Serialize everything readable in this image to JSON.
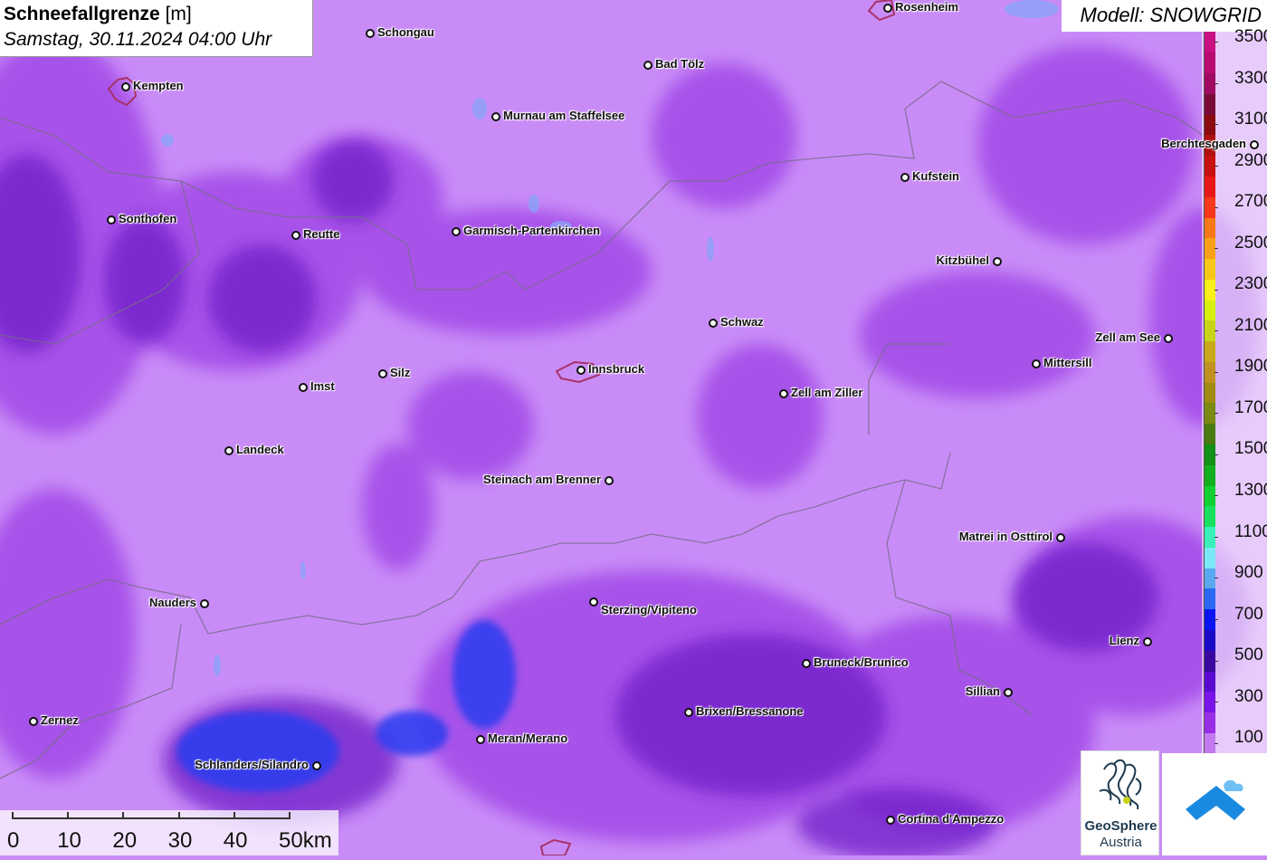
{
  "header": {
    "title_bold": "Schneefallgrenze",
    "title_unit": "[m]",
    "datetime": "Samstag, 30.11.2024 04:00 Uhr"
  },
  "model_label": "Modell: SNOWGRID",
  "legend": {
    "levels": [
      {
        "label": "100",
        "color": "#c27af0"
      },
      {
        "label": "",
        "color": "#9a2ee6"
      },
      {
        "label": "300",
        "color": "#7a14e8"
      },
      {
        "label": "",
        "color": "#5a0ad0"
      },
      {
        "label": "500",
        "color": "#3a0aa0"
      },
      {
        "label": "",
        "color": "#1a0ac8"
      },
      {
        "label": "700",
        "color": "#0a14f0"
      },
      {
        "label": "",
        "color": "#2a6af2"
      },
      {
        "label": "900",
        "color": "#5aa8f0"
      },
      {
        "label": "",
        "color": "#7ae8f6"
      },
      {
        "label": "1100",
        "color": "#3af0b8"
      },
      {
        "label": "",
        "color": "#1ae060"
      },
      {
        "label": "1300",
        "color": "#12d030"
      },
      {
        "label": "",
        "color": "#12b020"
      },
      {
        "label": "1500",
        "color": "#129018"
      },
      {
        "label": "",
        "color": "#4a7a12"
      },
      {
        "label": "1700",
        "color": "#7a8a12"
      },
      {
        "label": "",
        "color": "#a08a12"
      },
      {
        "label": "1900",
        "color": "#c09020"
      },
      {
        "label": "",
        "color": "#c8a818"
      },
      {
        "label": "2100",
        "color": "#c8d418"
      },
      {
        "label": "",
        "color": "#d8f010"
      },
      {
        "label": "2300",
        "color": "#f8f018"
      },
      {
        "label": "",
        "color": "#f8c818"
      },
      {
        "label": "2500",
        "color": "#f8a018"
      },
      {
        "label": "",
        "color": "#f87818"
      },
      {
        "label": "2700",
        "color": "#f83818"
      },
      {
        "label": "",
        "color": "#e81818"
      },
      {
        "label": "2900",
        "color": "#c81010"
      },
      {
        "label": "",
        "color": "#b01010"
      },
      {
        "label": "3100",
        "color": "#8a0a10"
      },
      {
        "label": "",
        "color": "#7a0a38"
      },
      {
        "label": "3300",
        "color": "#a00a60"
      },
      {
        "label": "",
        "color": "#b80a70"
      },
      {
        "label": "3500",
        "color": "#c81080"
      }
    ]
  },
  "scale_bar": {
    "labels": [
      "0",
      "10",
      "20",
      "30",
      "40",
      "50km"
    ]
  },
  "logo": {
    "name": "GeoSphere",
    "sub": "Austria"
  },
  "cities": [
    {
      "name": "Rosenheim",
      "dot": [
        981,
        9
      ],
      "side": "r"
    },
    {
      "name": "Schongau",
      "dot": [
        409,
        37
      ],
      "side": "r"
    },
    {
      "name": "Bad Tölz",
      "dot": [
        716,
        72
      ],
      "side": "r"
    },
    {
      "name": "Kempten",
      "dot": [
        139,
        96
      ],
      "side": "r"
    },
    {
      "name": "Murnau am Staffelsee",
      "dot": [
        548,
        129
      ],
      "side": "r"
    },
    {
      "name": "Berchtesgaden",
      "dot": [
        1386,
        160
      ],
      "side": "l"
    },
    {
      "name": "Kufstein",
      "dot": [
        1000,
        196
      ],
      "side": "r"
    },
    {
      "name": "Sonthofen",
      "dot": [
        123,
        243
      ],
      "side": "r"
    },
    {
      "name": "Garmisch-Partenkirchen",
      "dot": [
        504,
        256
      ],
      "side": "r"
    },
    {
      "name": "Reutte",
      "dot": [
        327,
        260
      ],
      "side": "r"
    },
    {
      "name": "Kitzbühel",
      "dot": [
        1102,
        289
      ],
      "side": "l"
    },
    {
      "name": "Schwaz",
      "dot": [
        788,
        357
      ],
      "side": "r"
    },
    {
      "name": "Zell am See",
      "dot": [
        1291,
        374
      ],
      "side": "l"
    },
    {
      "name": "Mittersill",
      "dot": [
        1145,
        402
      ],
      "side": "r"
    },
    {
      "name": "Innsbruck",
      "dot": [
        642,
        409
      ],
      "side": "r"
    },
    {
      "name": "Silz",
      "dot": [
        423,
        413
      ],
      "side": "r"
    },
    {
      "name": "Imst",
      "dot": [
        335,
        428
      ],
      "side": "r"
    },
    {
      "name": "Zell am Ziller",
      "dot": [
        866,
        435
      ],
      "side": "r"
    },
    {
      "name": "Landeck",
      "dot": [
        253,
        498
      ],
      "side": "r"
    },
    {
      "name": "Steinach am Brenner",
      "dot": [
        673,
        531
      ],
      "side": "l"
    },
    {
      "name": "Matrei in Osttirol",
      "dot": [
        1172,
        594
      ],
      "side": "l"
    },
    {
      "name": "Nauders",
      "dot": [
        226,
        667
      ],
      "side": "l"
    },
    {
      "name": "Sterzing/Vipiteno",
      "dot": [
        656,
        665
      ],
      "side": "rb"
    },
    {
      "name": "Lienz",
      "dot": [
        1268,
        709
      ],
      "side": "l"
    },
    {
      "name": "Bruneck/Brunico",
      "dot": [
        891,
        733
      ],
      "side": "r"
    },
    {
      "name": "Sillian",
      "dot": [
        1114,
        765
      ],
      "side": "l"
    },
    {
      "name": "Brixen/Bressanone",
      "dot": [
        761,
        787
      ],
      "side": "r"
    },
    {
      "name": "Zernez",
      "dot": [
        37,
        797
      ],
      "side": "r"
    },
    {
      "name": "Meran/Merano",
      "dot": [
        531,
        817
      ],
      "side": "r"
    },
    {
      "name": "Schlanders/Silandro",
      "dot": [
        350,
        846
      ],
      "side": "l"
    },
    {
      "name": "Cortina d'Ampezzo",
      "dot": [
        984,
        906
      ],
      "side": "r"
    }
  ]
}
